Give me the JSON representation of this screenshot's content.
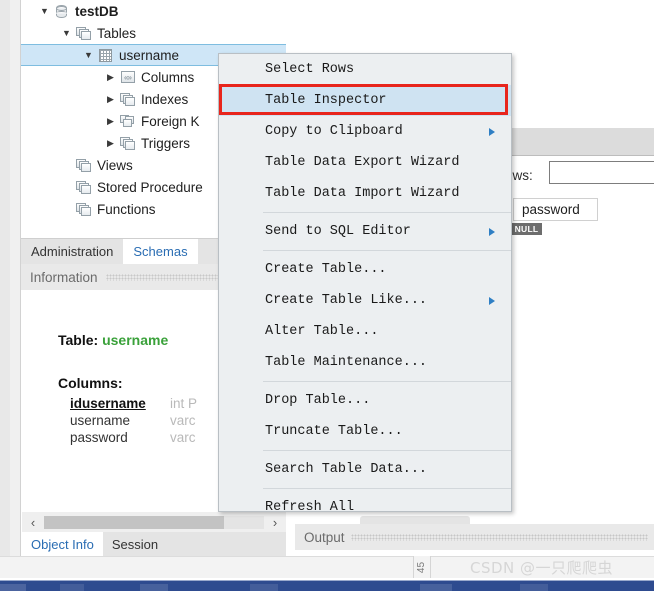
{
  "tree": {
    "items": [
      {
        "label": "testDB",
        "indent": 0,
        "twisty": "▼",
        "icon": "database-icon",
        "bold": true,
        "selected": false
      },
      {
        "label": "Tables",
        "indent": 1,
        "twisty": "▼",
        "icon": "folders-icon",
        "bold": false,
        "selected": false
      },
      {
        "label": "username",
        "indent": 2,
        "twisty": "▼",
        "icon": "table-grid-icon",
        "bold": false,
        "selected": true
      },
      {
        "label": "Columns",
        "indent": 3,
        "twisty": "▶",
        "icon": "columns-icon",
        "bold": false,
        "selected": false
      },
      {
        "label": "Indexes",
        "indent": 3,
        "twisty": "▶",
        "icon": "folders-icon",
        "bold": false,
        "selected": false
      },
      {
        "label": "Foreign K",
        "indent": 3,
        "twisty": "▶",
        "icon": "foreign-key-icon",
        "bold": false,
        "selected": false
      },
      {
        "label": "Triggers",
        "indent": 3,
        "twisty": "▶",
        "icon": "folders-icon",
        "bold": false,
        "selected": false
      },
      {
        "label": "Views",
        "indent": 1,
        "twisty": "",
        "icon": "folders-icon",
        "bold": false,
        "selected": false
      },
      {
        "label": "Stored Procedure",
        "indent": 1,
        "twisty": "",
        "icon": "folders-icon",
        "bold": false,
        "selected": false
      },
      {
        "label": "Functions",
        "indent": 1,
        "twisty": "",
        "icon": "folders-icon",
        "bold": false,
        "selected": false
      }
    ]
  },
  "lower_tabs": [
    {
      "label": "Administration",
      "active": false
    },
    {
      "label": "Schemas",
      "active": true
    }
  ],
  "info_panel": {
    "header": "Information",
    "table_label": "Table:",
    "table_name": "username",
    "columns_label": "Columns:",
    "columns": [
      {
        "name": "idusername",
        "type": "int P",
        "primary": true
      },
      {
        "name": "username",
        "type": "varc",
        "primary": false
      },
      {
        "name": "password",
        "type": "varc",
        "primary": false
      }
    ]
  },
  "bottom_tabs": [
    {
      "label": "Object Info",
      "active": true
    },
    {
      "label": "Session",
      "active": false
    }
  ],
  "hscroll": {
    "left_arrow": "‹",
    "right_arrow": "›"
  },
  "context_menu": {
    "items": [
      {
        "label": "Select Rows",
        "submenu": false,
        "highlight": false,
        "sep_after": false
      },
      {
        "label": "Table Inspector",
        "submenu": false,
        "highlight": true,
        "sep_after": false
      },
      {
        "label": "Copy to Clipboard",
        "submenu": true,
        "highlight": false,
        "sep_after": false
      },
      {
        "label": "Table Data Export Wizard",
        "submenu": false,
        "highlight": false,
        "sep_after": false
      },
      {
        "label": "Table Data Import Wizard",
        "submenu": false,
        "highlight": false,
        "sep_after": true
      },
      {
        "label": "Send to SQL Editor",
        "submenu": true,
        "highlight": false,
        "sep_after": true
      },
      {
        "label": "Create Table...",
        "submenu": false,
        "highlight": false,
        "sep_after": false
      },
      {
        "label": "Create Table Like...",
        "submenu": true,
        "highlight": false,
        "sep_after": false
      },
      {
        "label": "Alter Table...",
        "submenu": false,
        "highlight": false,
        "sep_after": false
      },
      {
        "label": "Table Maintenance...",
        "submenu": false,
        "highlight": false,
        "sep_after": true
      },
      {
        "label": "Drop Table...",
        "submenu": false,
        "highlight": false,
        "sep_after": false
      },
      {
        "label": "Truncate Table...",
        "submenu": false,
        "highlight": false,
        "sep_after": true
      },
      {
        "label": "Search Table Data...",
        "submenu": false,
        "highlight": false,
        "sep_after": true
      },
      {
        "label": "Refresh All",
        "submenu": false,
        "highlight": false,
        "sep_after": false
      }
    ],
    "highlight_outline_color": "#e8251c"
  },
  "right_panel": {
    "rows_label": "ows:",
    "rows_input_value": "",
    "rows_input_placeholder": "",
    "cell_value": "password",
    "null_badge": "NULL"
  },
  "output_panel": {
    "label": "Output"
  },
  "statusbar": {
    "rotated_number": "45",
    "watermark": "CSDN @一只爬爬虫"
  }
}
